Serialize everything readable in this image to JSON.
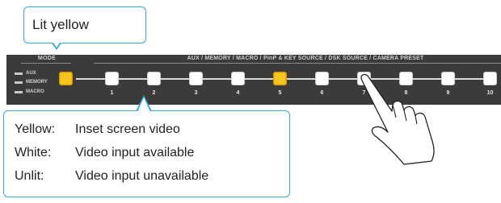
{
  "panel": {
    "mode_label": "MODE",
    "bank_label": "AUX / MEMORY / MACRO / PinP & KEY SOURCE / DSK SOURCE / CAMERA PRESET",
    "indicators": [
      "AUX",
      "MEMORY",
      "MACRO"
    ],
    "buttons": [
      "1",
      "2",
      "3",
      "4",
      "5",
      "6",
      "7",
      "8",
      "9",
      "10"
    ]
  },
  "callout_top": {
    "text": "Lit yellow"
  },
  "legend": {
    "rows": [
      {
        "key": "Yellow:",
        "value": "Inset screen video"
      },
      {
        "key": "White:",
        "value": "Video input available"
      },
      {
        "key": "Unlit:",
        "value": "Video input unavailable"
      }
    ]
  },
  "colors": {
    "yellow": "#f7c521",
    "white": "#ffffff",
    "panel": "#3b3b3b",
    "callout_border": "#36a9d6"
  }
}
